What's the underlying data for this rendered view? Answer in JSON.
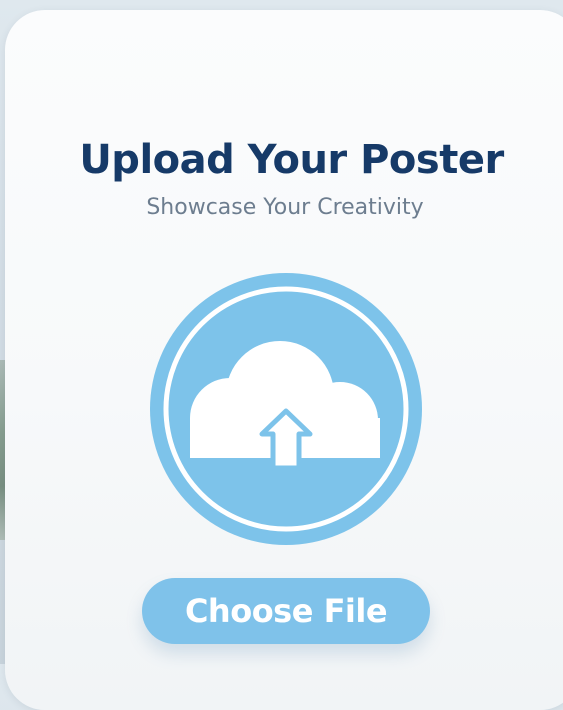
{
  "card": {
    "title": "Upload Your Poster",
    "subtitle": "Showcase Your Creativity"
  },
  "upload_icon": {
    "icon": "cloud-upload-icon",
    "fill_color": "#7dc3ea"
  },
  "choose_button": {
    "label": "Choose File",
    "color": "#7fc2ea"
  },
  "colors": {
    "title": "#163a68",
    "subtitle": "#6d7d8f",
    "card_background": "#f8fafb"
  }
}
